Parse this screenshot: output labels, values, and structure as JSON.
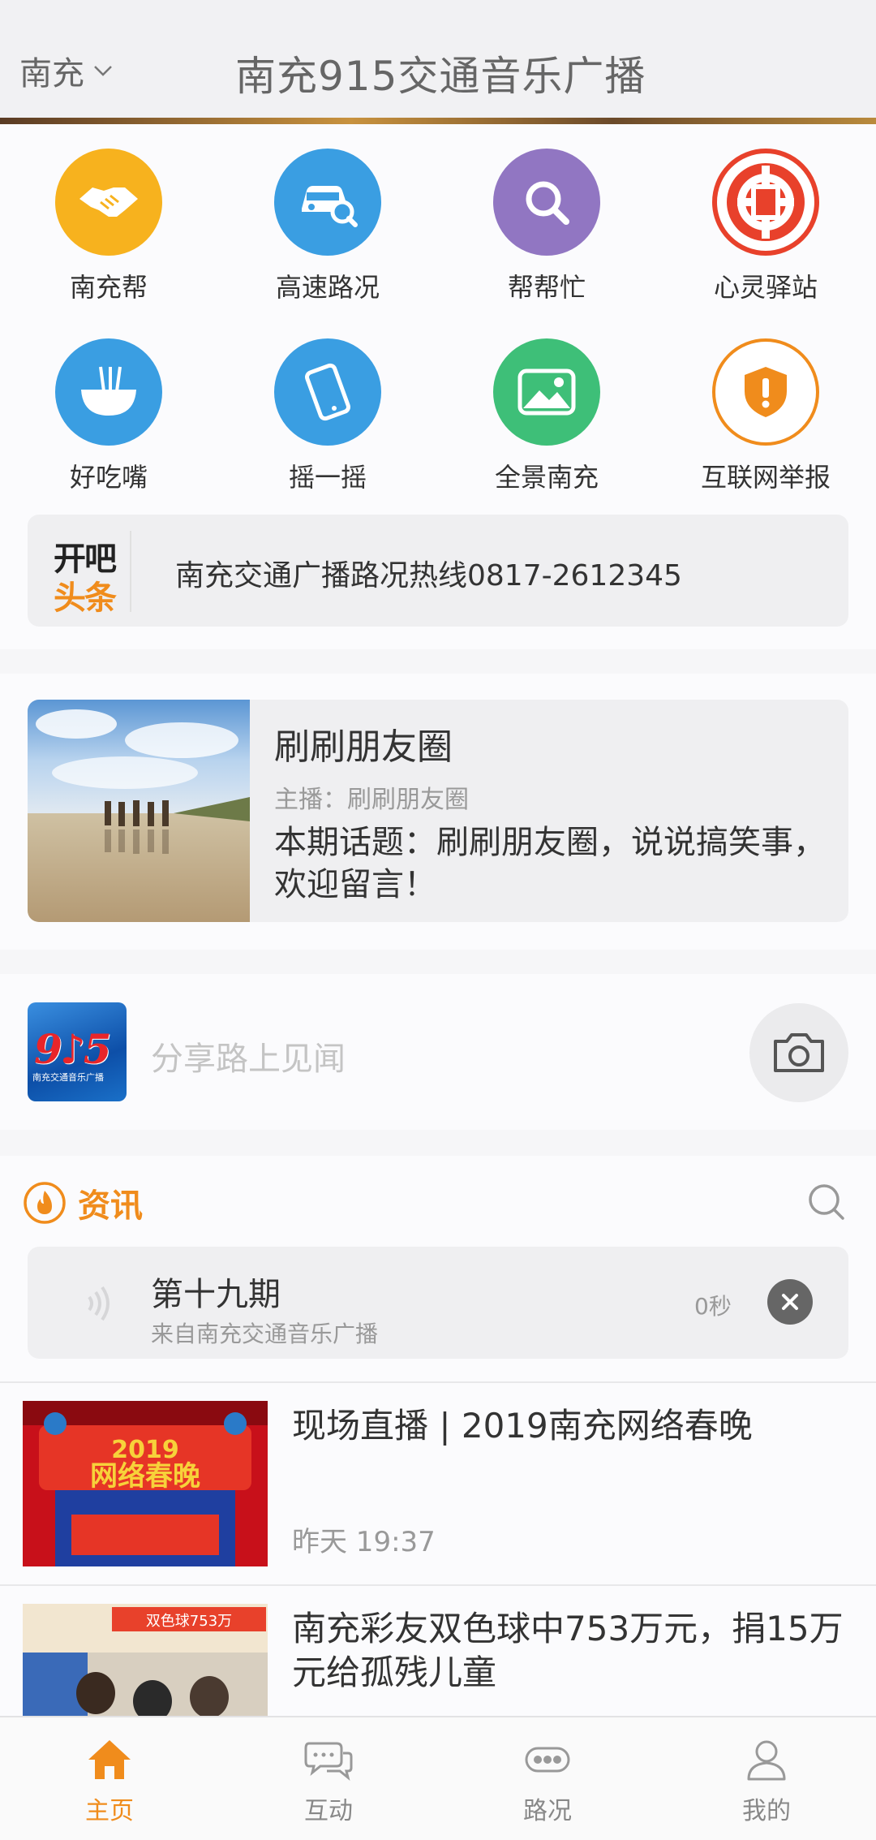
{
  "header": {
    "city": "南充",
    "title": "南充915交通音乐广播"
  },
  "grid": [
    {
      "label": "南充帮",
      "icon": "handshake-icon",
      "color": "#f7b21e"
    },
    {
      "label": "高速路况",
      "icon": "car-search-icon",
      "color": "#3a9ee2"
    },
    {
      "label": "帮帮忙",
      "icon": "search-icon",
      "color": "#9176c2"
    },
    {
      "label": "心灵驿站",
      "icon": "union-logo-icon",
      "color": "#e8412b"
    },
    {
      "label": "好吃嘴",
      "icon": "noodle-bowl-icon",
      "color": "#3a9ee2"
    },
    {
      "label": "摇一摇",
      "icon": "phone-shake-icon",
      "color": "#3a9ee2"
    },
    {
      "label": "全景南充",
      "icon": "landscape-icon",
      "color": "#3ebf78"
    },
    {
      "label": "互联网举报",
      "icon": "shield-alert-icon",
      "color": "#f08c1c"
    }
  ],
  "headline": {
    "logo_line1": "开吧",
    "logo_line2": "头条",
    "text": "南充交通广播路况热线0817-2612345"
  },
  "program": {
    "name": "刷刷朋友圈",
    "host": "主播：刷刷朋友圈",
    "topic": "本期话题：刷刷朋友圈，说说搞笑事，欢迎留言！"
  },
  "share": {
    "logo_text": "9♪5",
    "logo_sub": "南充交通音乐广播",
    "placeholder": "分享路上见闻"
  },
  "news": {
    "section_label": "资讯",
    "audio": {
      "title": "第十九期",
      "source": "来自南充交通音乐广播",
      "duration": "0秒"
    },
    "items": [
      {
        "title": "现场直播 | 2019南充网络春晚",
        "time": "昨天 19:37"
      },
      {
        "title": "南充彩友双色球中753万元，捐15万元给孤残儿童",
        "time": ""
      }
    ]
  },
  "nav": [
    {
      "label": "主页",
      "active": true
    },
    {
      "label": "互动",
      "active": false
    },
    {
      "label": "路况",
      "active": false
    },
    {
      "label": "我的",
      "active": false
    }
  ],
  "colors": {
    "accent": "#f08c1c"
  }
}
